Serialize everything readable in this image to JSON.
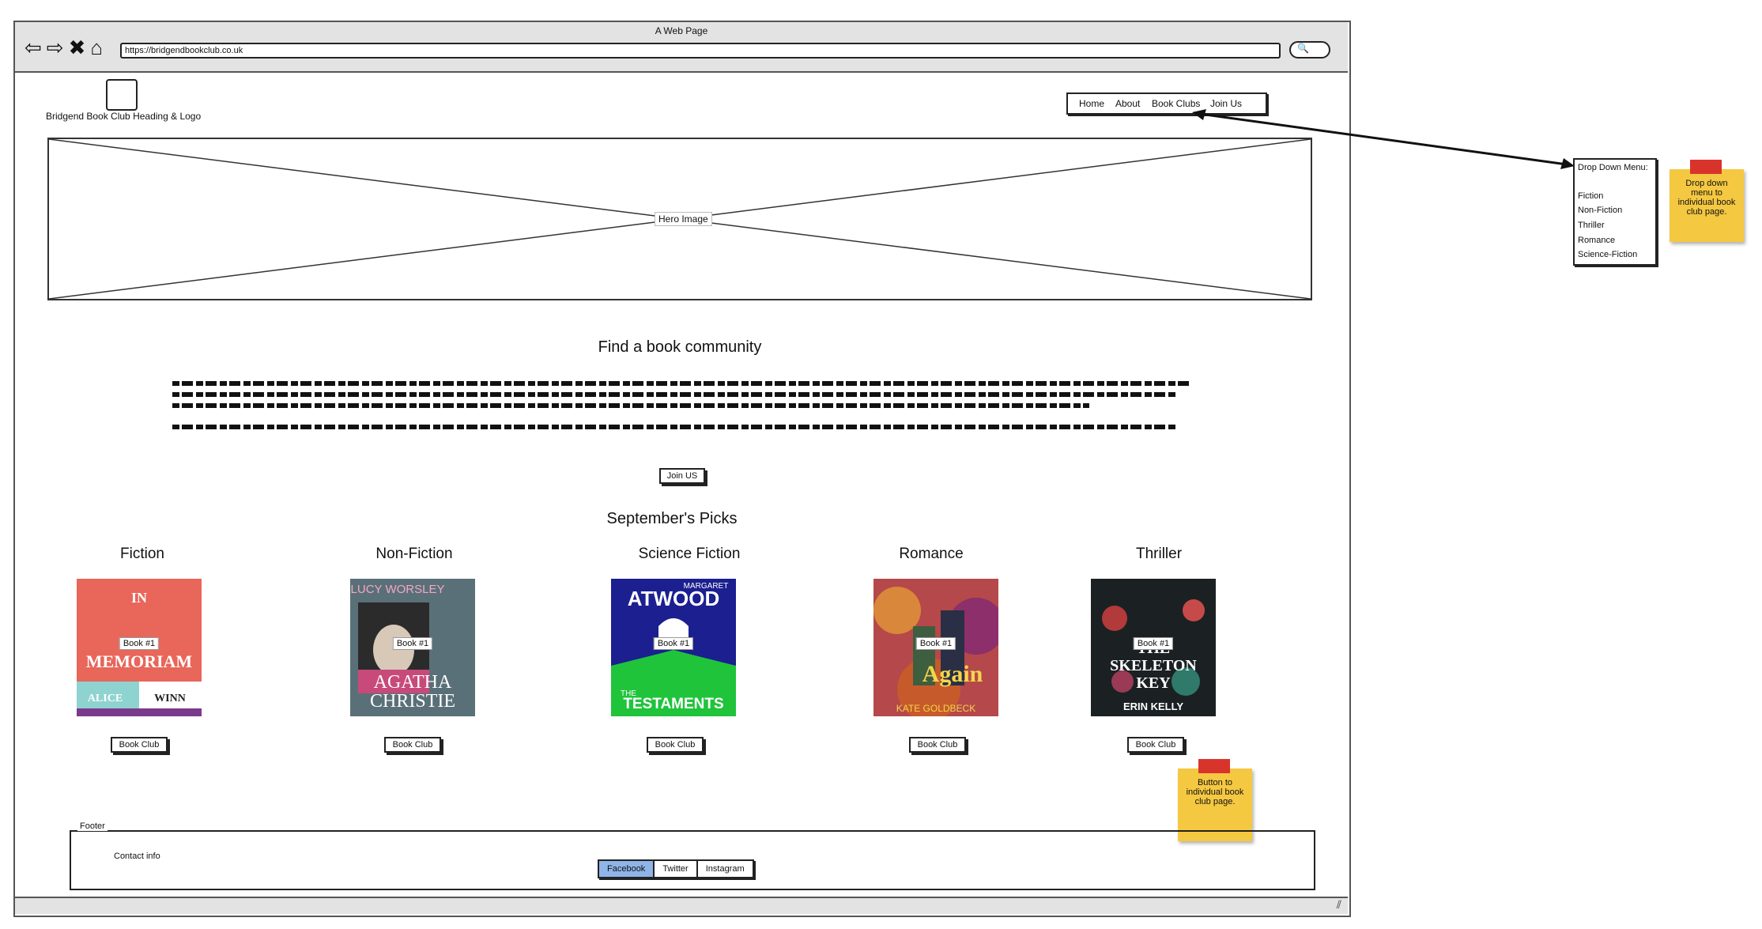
{
  "window": {
    "title": "A Web Page",
    "url": "https://bridgendbookclub.co.uk"
  },
  "header": {
    "logo_text": "Bridgend Book Club Heading & Logo",
    "nav": [
      "Home",
      "About",
      "Book Clubs",
      "Join Us"
    ]
  },
  "hero": {
    "label": "Hero Image"
  },
  "intro": {
    "heading": "Find a book community",
    "button": "Join US"
  },
  "picks": {
    "heading": "September's Picks",
    "book_label": "Book #1",
    "button": "Book Club",
    "categories": [
      {
        "name": "Fiction",
        "cover_text": [
          "IN",
          "MEMORIAM",
          "ALICE",
          "WINN"
        ]
      },
      {
        "name": "Non-Fiction",
        "cover_text": [
          "LUCY WORSLEY",
          "AGATHA",
          "CHRISTIE"
        ]
      },
      {
        "name": "Science Fiction",
        "cover_text": [
          "MARGARET",
          "ATWOOD",
          "THE",
          "TESTAMENTS"
        ]
      },
      {
        "name": "Romance",
        "cover_text": [
          "Again",
          "KATE GOLDBECK"
        ]
      },
      {
        "name": "Thriller",
        "cover_text": [
          "THE",
          "SKELETON",
          "KEY",
          "ERIN KELLY"
        ]
      }
    ]
  },
  "annotations": {
    "dropdown_title": "Drop Down Menu:",
    "dropdown_items": [
      "Fiction",
      "Non-Fiction",
      "Thriller",
      "Romance",
      "Science-Fiction"
    ],
    "note_dropdown": "Drop down menu to individual book club page.",
    "note_button": "Button to individual book club page."
  },
  "footer": {
    "legend": "Footer",
    "contact": "Contact info",
    "social": [
      "Facebook",
      "Twitter",
      "Instagram"
    ]
  },
  "colors": {
    "window_chrome": "#e3e3e3",
    "sticky_note": "#f5c842",
    "sticky_tape": "#d9342b",
    "facebook_highlight": "#8fb4e8"
  }
}
